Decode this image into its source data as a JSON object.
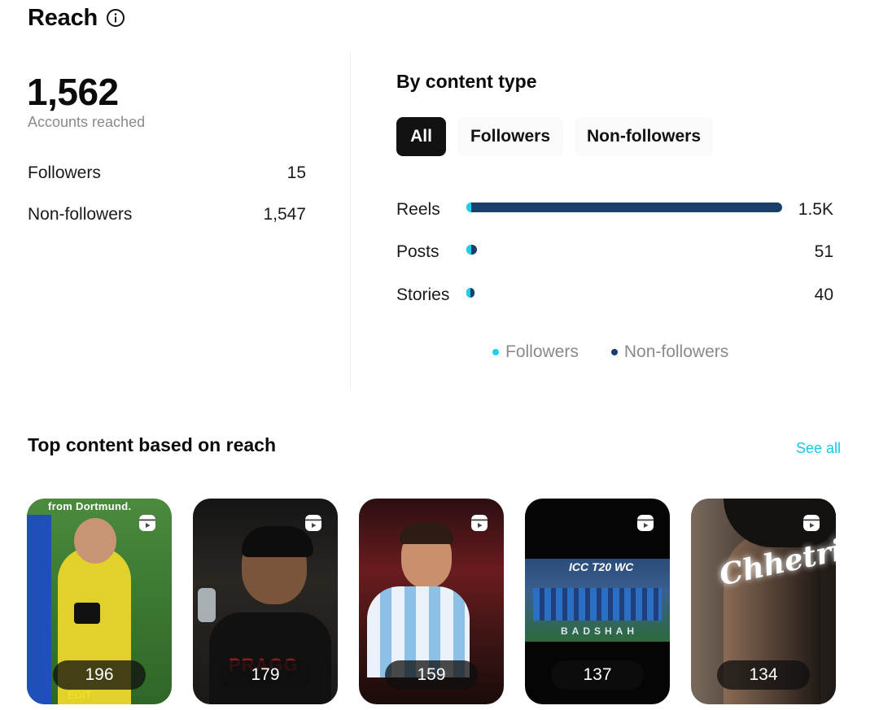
{
  "reach": {
    "title": "Reach",
    "total": "1,562",
    "total_label": "Accounts reached",
    "breakdown": [
      {
        "label": "Followers",
        "value": "15"
      },
      {
        "label": "Non-followers",
        "value": "1,547"
      }
    ]
  },
  "by_content": {
    "title": "By content type",
    "tabs": [
      {
        "label": "All",
        "selected": true
      },
      {
        "label": "Followers",
        "selected": false
      },
      {
        "label": "Non-followers",
        "selected": false
      }
    ],
    "rows": [
      {
        "label": "Reels",
        "value": "1.5K"
      },
      {
        "label": "Posts",
        "value": "51"
      },
      {
        "label": "Stories",
        "value": "40"
      }
    ],
    "legend": [
      {
        "label": "Followers",
        "color": "#1ad1ec"
      },
      {
        "label": "Non-followers",
        "color": "#1a3f6c"
      }
    ]
  },
  "top_content": {
    "title": "Top content based on reach",
    "see_all": "See all",
    "items": [
      {
        "count": "196",
        "caption_top": "from Dortmund.",
        "caption_bottom": "EDIT",
        "icon": "reel-icon"
      },
      {
        "count": "179",
        "caption_top": "",
        "caption_bottom": "PRAGG",
        "icon": "reel-icon"
      },
      {
        "count": "159",
        "caption_top": "",
        "caption_bottom": "",
        "icon": "reel-icon"
      },
      {
        "count": "137",
        "caption_top": "ICC T20 WC",
        "caption_bottom": "BADSHAH",
        "icon": "reel-icon"
      },
      {
        "count": "134",
        "caption_top": "Chhetri",
        "caption_bottom": "",
        "icon": "reel-icon"
      }
    ]
  }
}
